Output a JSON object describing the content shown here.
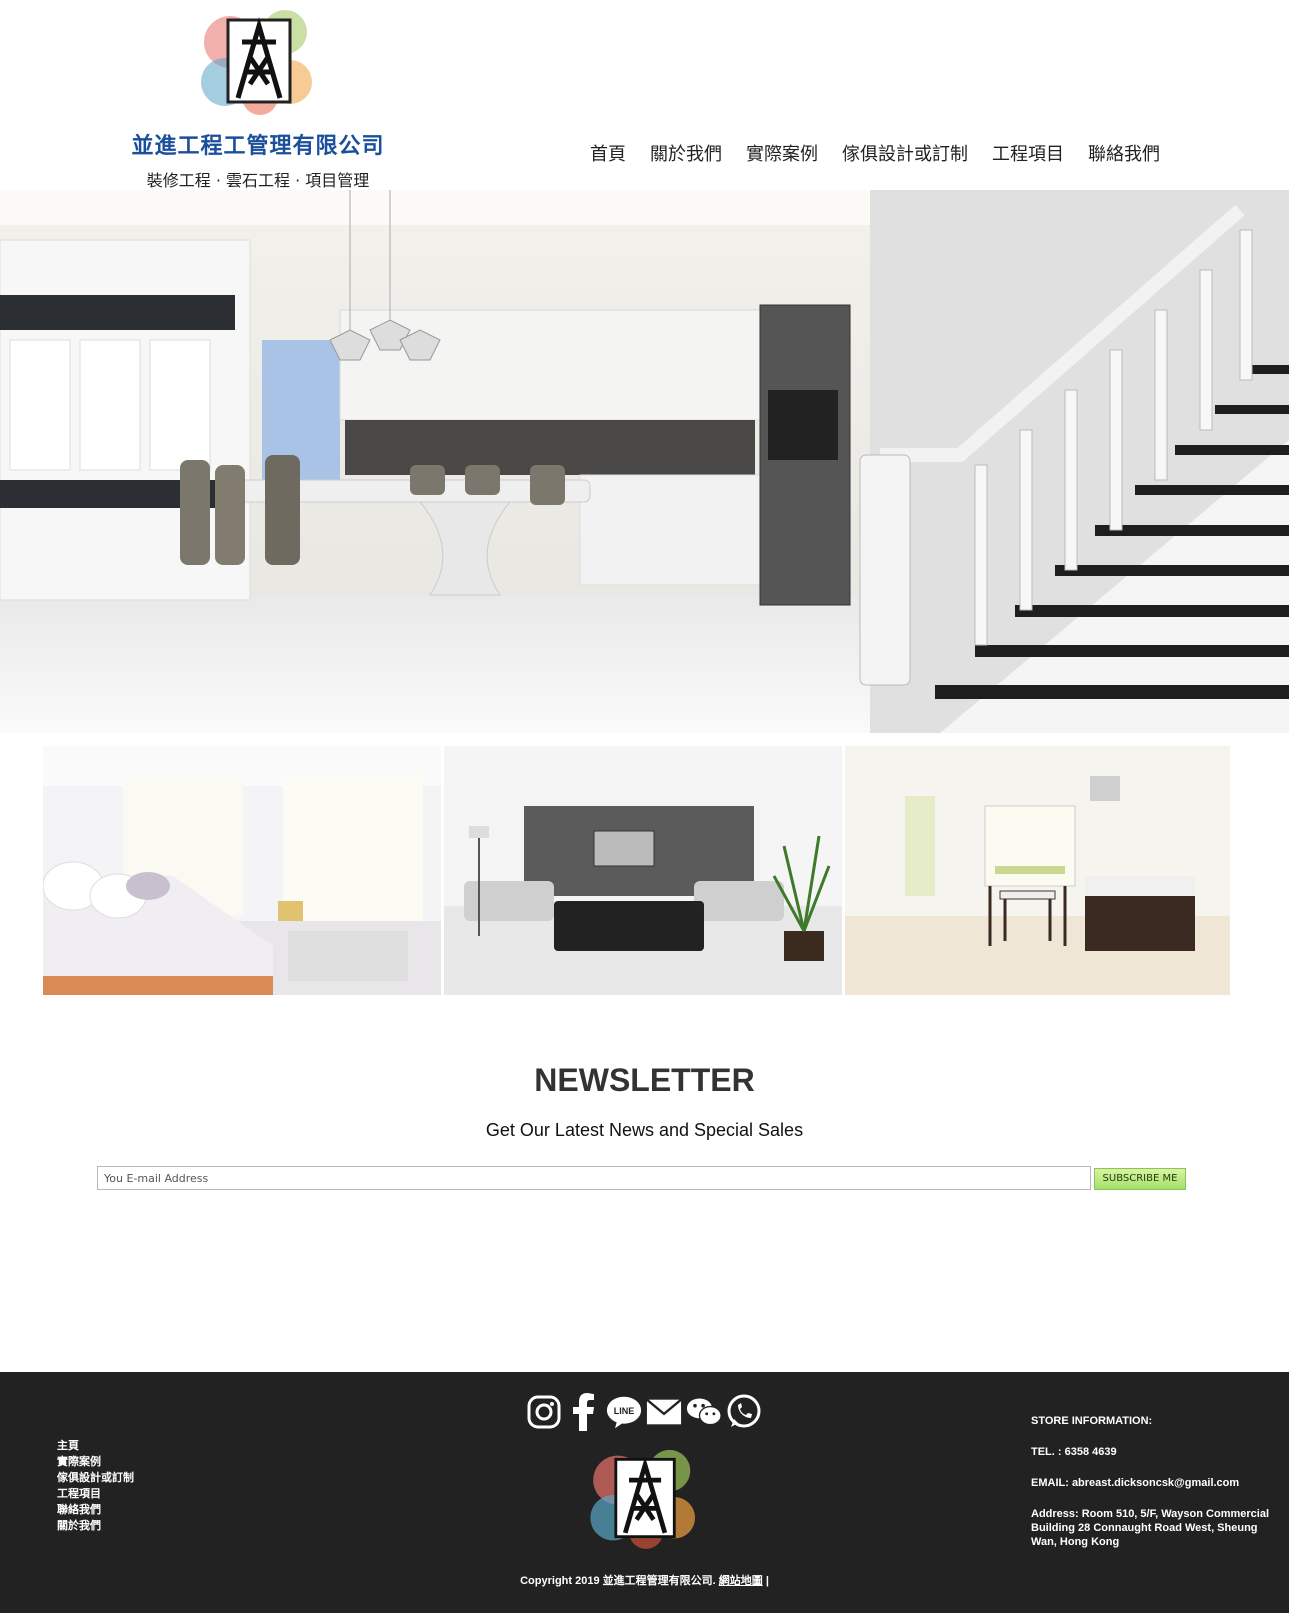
{
  "header": {
    "company_name": "並進工程工管理有限公司",
    "tagline": "裝修工程 · 雲石工程 · 項目管理",
    "logo_alt": "A-frame logo"
  },
  "nav": {
    "items": [
      {
        "label": "首頁"
      },
      {
        "label": "關於我們"
      },
      {
        "label": "實際案例"
      },
      {
        "label": "傢俱設計或訂制"
      },
      {
        "label": "工程項目"
      },
      {
        "label": "聯絡我們"
      }
    ]
  },
  "hero": {
    "image": "kitchen-dining-staircase-photo"
  },
  "gallery": {
    "items": [
      {
        "image": "bedroom-photo"
      },
      {
        "image": "living-room-photo"
      },
      {
        "image": "dining-kitchen-photo"
      }
    ]
  },
  "newsletter": {
    "title": "NEWSLETTER",
    "subtitle": "Get Our Latest News and Special Sales",
    "email_placeholder": "You E-mail Address",
    "button_label": "SUBSCRIBE ME"
  },
  "footer": {
    "links": [
      {
        "label": "主頁"
      },
      {
        "label": "實際案例"
      },
      {
        "label": "傢俱設計或訂制"
      },
      {
        "label": "工程項目"
      },
      {
        "label": "聯絡我們"
      },
      {
        "label": "關於我們"
      }
    ],
    "social_icons": [
      "instagram-icon",
      "facebook-icon",
      "line-icon",
      "email-icon",
      "wechat-icon",
      "whatsapp-icon"
    ],
    "line_text": "LINE",
    "store_heading": "STORE INFORMATION:",
    "tel": "TEL. : 6358 4639",
    "email": "EMAIL: abreast.dicksoncsk@gmail.com",
    "address": "Address: Room 510, 5/F, Wayson Commercial Building 28 Connaught Road West, Sheung Wan, Hong Kong",
    "copyright": "Copyright 2019 並進工程管理有限公司.",
    "sitemap_label": "網站地圖",
    "separator": "|"
  },
  "colors": {
    "brand_blue": "#1a4f9c",
    "footer_bg": "#222222",
    "button_green": "#a6e06a"
  }
}
